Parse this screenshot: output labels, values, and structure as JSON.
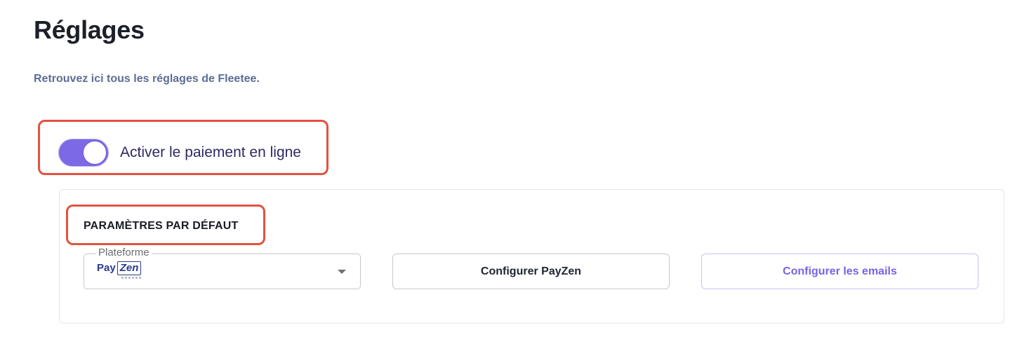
{
  "header": {
    "title": "Réglages",
    "subtitle": "Retrouvez ici tous les réglages de Fleetee."
  },
  "online_payment": {
    "toggle_label": "Activer le paiement en ligne",
    "enabled": true
  },
  "default_settings": {
    "section_title": "PARAMÈTRES PAR DÉFAUT",
    "platform": {
      "label": "Plateforme",
      "selected_value": "PayZen",
      "logo_text_pay": "Pay",
      "logo_text_zen": "Zen",
      "icon": "chevron-down-icon"
    },
    "configure_payzen_label": "Configurer PayZen",
    "configure_emails_label": "Configurer les emails"
  },
  "colors": {
    "accent": "#7B69E6",
    "highlight": "#E0533F",
    "subtitle": "#5B6E95",
    "toggle_label": "#2C2A63"
  }
}
